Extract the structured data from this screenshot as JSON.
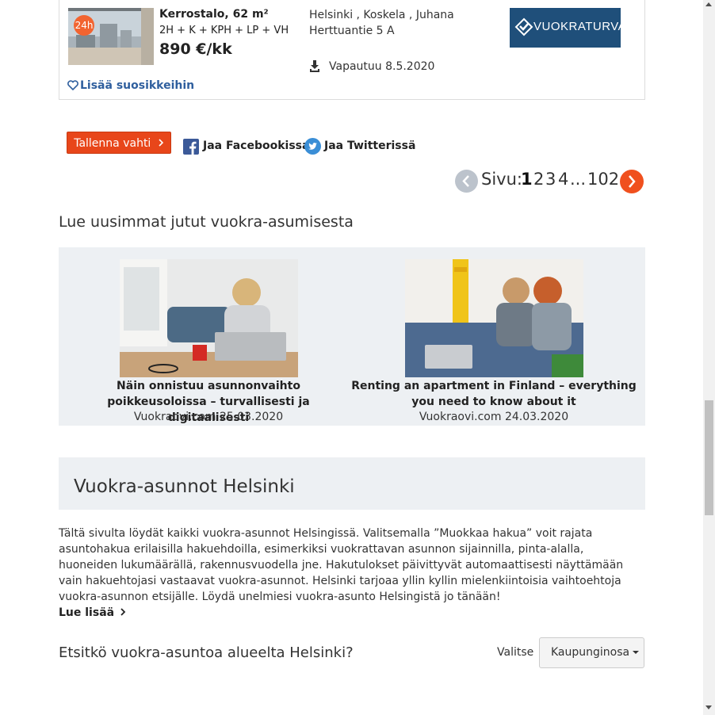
{
  "listing": {
    "badge": "24h",
    "type": "Kerrostalo, 62 m²",
    "rooms": "2H + K + KPH + LP + VH",
    "price": "890 €/kk",
    "address_line1": "Helsinki , Koskela , Juhana",
    "address_line2": "Herttuantie 5 A",
    "available": "Vapautuu 8.5.2020",
    "agency_logo_text": "VUOKRATURVA",
    "favorite_label": "Lisää suosikkeihin"
  },
  "actions": {
    "save_label": "Tallenna vahti",
    "facebook_label": "Jaa Facebookissa",
    "twitter_label": "Jaa Twitterissä"
  },
  "pagination": {
    "label": "Sivu:",
    "current": "1",
    "pages": [
      "2",
      "3",
      "4"
    ],
    "ellipsis": "...",
    "last": "102"
  },
  "articles": {
    "heading": "Lue uusimmat jutut vuokra-asumisesta",
    "items": [
      {
        "title": "Näin onnistuu asunnonvaihto poikkeusoloissa – turvallisesti ja digitaalisesti",
        "meta": "Vuokraovi.com 25.03.2020"
      },
      {
        "title": "Renting an apartment in Finland – everything you need to know about it",
        "meta": "Vuokraovi.com 24.03.2020"
      }
    ]
  },
  "section": {
    "title": "Vuokra-asunnot Helsinki",
    "description": "Tältä sivulta löydät kaikki vuokra-asunnot Helsingissä. Valitsemalla ”Muokkaa hakua” voit rajata asuntohakua erilaisilla hakuehdoilla, esimerkiksi vuokrattavan asunnon sijainnilla, pinta-alalla, huoneiden lukumäärällä, rakennusvuodella jne. Hakutulokset päivittyvät automaattisesti näyttämään vain hakuehtojasi vastaavat vuokra-asunnot. Helsinki tarjoaa yllin kyllin mielenkiintoisia vaihtoehtoja vuokra-asunnon etsijälle. Löydä unelmiesi vuokra-asunto Helsingistä jo tänään!",
    "read_more": "Lue lisää",
    "question": "Etsitkö vuokra-asuntoa alueelta Helsinki?",
    "select_label": "Valitse",
    "select_value": "Kaupunginosa"
  },
  "colors": {
    "accent": "#e8461a",
    "link": "#2f5f9e",
    "panel": "#edf0f3"
  }
}
